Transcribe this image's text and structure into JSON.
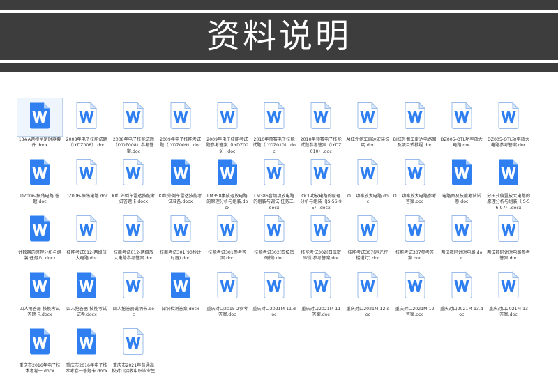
{
  "banner": {
    "title": "资料说明"
  },
  "files": [
    {
      "name": "13#A题模型定时器套件.docx",
      "icon": "blue"
    },
    {
      "name": "2008年电子技能试题（LYDZ008）.doc",
      "icon": "white"
    },
    {
      "name": "2008年电子技能试题（LYDZ008）参考答案.doc",
      "icon": "white"
    },
    {
      "name": "2009年电子技能考试题（LYDZ009）.doc",
      "icon": "white"
    },
    {
      "name": "2009年电子技能考试题参考答案（LYDZ009）.doc",
      "icon": "white"
    },
    {
      "name": "2010年预赛电子技能试题（LYDZ010）.doc",
      "icon": "white"
    },
    {
      "name": "2010年预赛电子技能试题参考答案（LYDZ010）.doc",
      "icon": "white"
    },
    {
      "name": "AI红外倒车雷达安装说明.doc",
      "icon": "white"
    },
    {
      "name": "BI红外倒车雷达电路图及项目式教程.doc",
      "icon": "white"
    },
    {
      "name": "DZ005-OTL功率放大电路.doc",
      "icon": "white"
    },
    {
      "name": "DZ005-OTL功率放大电路参考答案.doc",
      "icon": "white"
    },
    {
      "name": "DZ006-振荡电路 答题.doc",
      "icon": "blue"
    },
    {
      "name": "DZ006-振荡电路.doc",
      "icon": "white"
    },
    {
      "name": "KI红外倒车雷达技能考试答题卡.docx",
      "icon": "white"
    },
    {
      "name": "KI红外倒车雷达技能考试准备.docx",
      "icon": "blue"
    },
    {
      "name": "LM358集成运放电路的原理分析与组装.docx",
      "icon": "blue"
    },
    {
      "name": "LM386音频功放电路的组装与调试 任务二.docx",
      "icon": "white"
    },
    {
      "name": "OCL功放电路的原理分析与组装（JS-56-95）.docx",
      "icon": "white"
    },
    {
      "name": "OTL功率放大电路.doc",
      "icon": "white"
    },
    {
      "name": "OTL功率放大电路参考答案.doc",
      "icon": "white"
    },
    {
      "name": "电路图及技能考试试卷.doc",
      "icon": "blue"
    },
    {
      "name": "分压式偏置放大电路的原理分析与组装（JS-56-97）.docx",
      "icon": "blue"
    },
    {
      "name": "计数器的原理分析与组装 任务八 .docx",
      "icon": "blue"
    },
    {
      "name": "技能考试012-两级放大电路.doc",
      "icon": "white"
    },
    {
      "name": "技能考试012-两级放大电路参考答案.doc",
      "icon": "white"
    },
    {
      "name": "技能考试301(90秒计时器).doc",
      "icon": "white"
    },
    {
      "name": "技能考试301参考答案.doc",
      "icon": "white"
    },
    {
      "name": "技能考试302(四位密码锁).doc",
      "icon": "white"
    },
    {
      "name": "技能考试302(四位密码锁)参考答案.doc",
      "icon": "white"
    },
    {
      "name": "技能考试307(声光控楼道灯).doc",
      "icon": "white"
    },
    {
      "name": "技能考试307参考答案.doc",
      "icon": "white"
    },
    {
      "name": "两位数码计时电路.doc",
      "icon": "white"
    },
    {
      "name": "两位数码计时电路参考答案.doc",
      "icon": "white"
    },
    {
      "name": "四人抢答器-技能考试答题卡.docx",
      "icon": "blue"
    },
    {
      "name": "四人抢答器-技能考试试卷.docx",
      "icon": "blue"
    },
    {
      "name": "四人抢答器说明书.doc",
      "icon": "white"
    },
    {
      "name": "知识检测答案.docx",
      "icon": "blue"
    },
    {
      "name": "重庆对口2015-2参考答案.doc",
      "icon": "white"
    },
    {
      "name": "重庆对口2021M-11.doc",
      "icon": "white"
    },
    {
      "name": "重庆对口2021M-11答案.doc",
      "icon": "white"
    },
    {
      "name": "重庆对口2021M-12.doc",
      "icon": "white"
    },
    {
      "name": "重庆对口2021M-12答案.doc",
      "icon": "white"
    },
    {
      "name": "重庆对口2021M-13.doc",
      "icon": "white"
    },
    {
      "name": "重庆对口2021M-13答案.doc",
      "icon": "white"
    },
    {
      "name": "重庆市2016年电子技术考卷一.docx",
      "icon": "blue"
    },
    {
      "name": "重庆市2016年电子技术考卷一答题卡.docx",
      "icon": "blue"
    },
    {
      "name": "重庆市2021年普通高校对口招收中职毕业生",
      "icon": "white"
    }
  ]
}
